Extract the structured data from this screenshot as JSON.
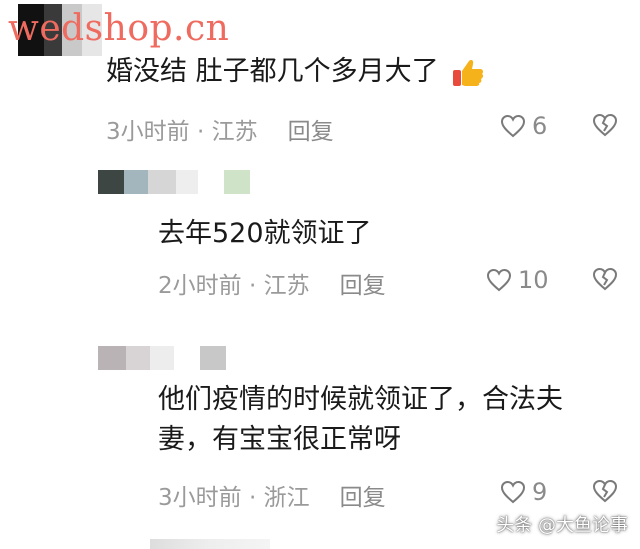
{
  "watermark": "wedshop.cn",
  "comments": [
    {
      "text": "婚没结 肚子都几个多月大了",
      "time_location": "3小时前 · 江苏",
      "reply_label": "回复",
      "likes": "6",
      "emoji": "thumbs-up-icon"
    },
    {
      "text": "去年520就领证了",
      "time_location": "2小时前 · 江苏",
      "reply_label": "回复",
      "likes": "10"
    },
    {
      "text_line1": "他们疫情的时候就领证了，合法夫",
      "text_line2": "妻，有宝宝很正常呀",
      "time_location": "3小时前 · 浙江",
      "reply_label": "回复",
      "likes": "9"
    }
  ],
  "footer": "头条 @大鱼论事",
  "icons": {
    "like": "heart-outline-icon",
    "dislike": "broken-heart-icon"
  },
  "colors": {
    "watermark": "#ef6b5f",
    "meta_text": "#8e8e8e",
    "body_text": "#1a1a1a"
  }
}
